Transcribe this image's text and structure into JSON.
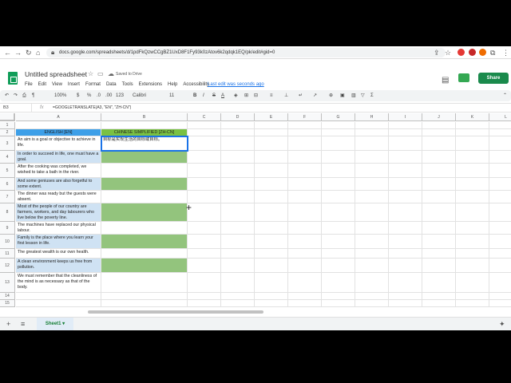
{
  "browser": {
    "url": "docs.google.com/spreadsheets/d/1pdFkQzwCCgBZ1UxD8F1Fy93k0zAtov6k2qdqk1EQ/pk/edit#gid=0"
  },
  "doc": {
    "title": "Untitled spreadsheet",
    "saved_status": "Saved to Drive",
    "last_edit": "Last edit was seconds ago",
    "share_label": "Share"
  },
  "menu": [
    "File",
    "Edit",
    "View",
    "Insert",
    "Format",
    "Data",
    "Tools",
    "Extensions",
    "Help",
    "Accessibility"
  ],
  "toolbar": {
    "zoom": "100%",
    "currency": "$",
    "percent": "%",
    "dec_less": ".0",
    "dec_more": ".00",
    "format_more": "123",
    "font": "Calibri",
    "font_size": "11"
  },
  "formula_bar": {
    "cell_ref": "B3",
    "formula": "=GOOGLETRANSLATE(A3, \"EN\", \"ZH-CN\")"
  },
  "grid": {
    "columns": [
      "A",
      "B",
      "C",
      "D",
      "E",
      "F",
      "G",
      "H",
      "I",
      "J",
      "K",
      "L"
    ],
    "rows": [
      "1",
      "2",
      "3",
      "4",
      "5",
      "6",
      "7",
      "8",
      "9",
      "10",
      "11",
      "12",
      "13",
      "14",
      "15"
    ],
    "header_a": "ENGLISH [EN]",
    "header_b": "CHINESE SIMPLIFIED [ZH-CN]",
    "col_a": [
      "An aim is a goal or objective to achieve in life.",
      "In order to succeed in life, one must have a goal.",
      "After the cooking was completed, we wished to take a bath in the river.",
      "And some geniuses are also forgetful to some extent.",
      "The dinner was ready but the guests were absent.",
      "Most of the people of our country are farmers, workers, and day labourers who live below the poverty line.",
      "The machines have replaced our physical labour.",
      "Family is the place where you learn your first lesson in life.",
      "The greatest wealth is our own health.",
      "A clean environment keeps us free from pollution.",
      "We must remember that the cleanliness of the mind is as necessary as that of the body."
    ],
    "col_b": [
      "目标是实现生活的目标或目标。",
      "",
      "",
      "",
      "",
      "",
      "",
      "",
      "",
      "",
      ""
    ]
  },
  "sheet_tabs": [
    "Sheet1"
  ]
}
